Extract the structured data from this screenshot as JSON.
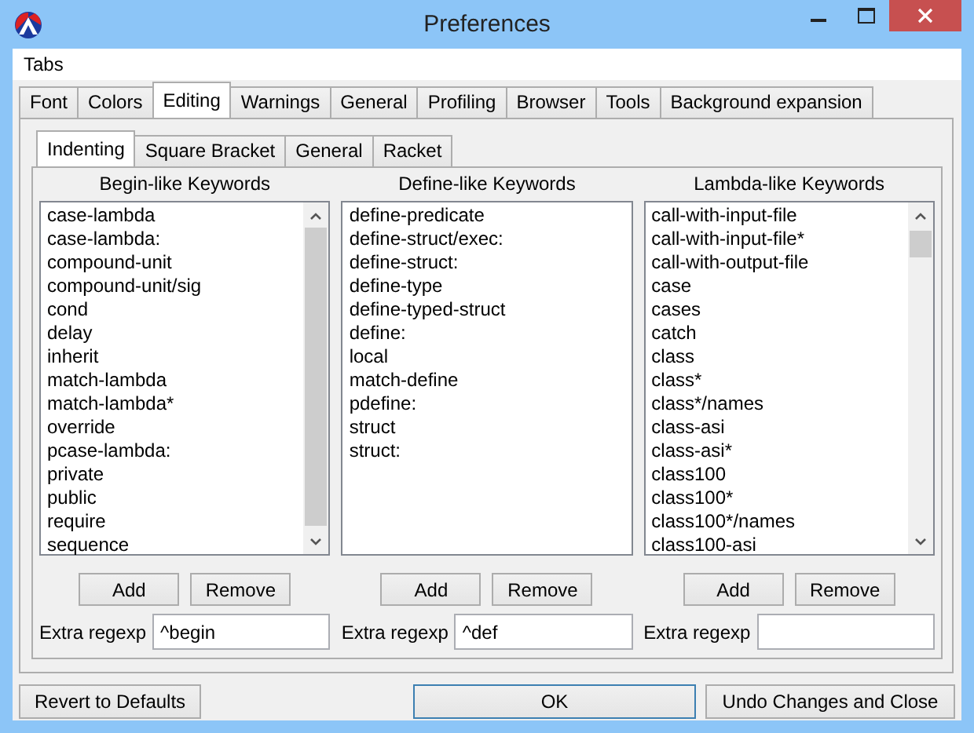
{
  "window": {
    "title": "Preferences"
  },
  "menu": [
    "Tabs"
  ],
  "tabs": [
    {
      "label": "Font",
      "selected": false
    },
    {
      "label": "Colors",
      "selected": false
    },
    {
      "label": "Editing",
      "selected": true
    },
    {
      "label": "Warnings",
      "selected": false
    },
    {
      "label": "General",
      "selected": false
    },
    {
      "label": "Profiling",
      "selected": false
    },
    {
      "label": "Browser",
      "selected": false
    },
    {
      "label": "Tools",
      "selected": false
    },
    {
      "label": "Background expansion",
      "selected": false
    }
  ],
  "subtabs": [
    {
      "label": "Indenting",
      "selected": true
    },
    {
      "label": "Square Bracket",
      "selected": false
    },
    {
      "label": "General",
      "selected": false
    },
    {
      "label": "Racket",
      "selected": false
    }
  ],
  "columns": [
    {
      "heading": "Begin-like Keywords",
      "items": [
        "case-lambda",
        "case-lambda:",
        "compound-unit",
        "compound-unit/sig",
        "cond",
        "delay",
        "inherit",
        "match-lambda",
        "match-lambda*",
        "override",
        "pcase-lambda:",
        "private",
        "public",
        "require",
        "sequence"
      ],
      "buttons": [
        "Add",
        "Remove"
      ],
      "regexp_label": "Extra regexp",
      "regexp_value": "^begin"
    },
    {
      "heading": "Define-like Keywords",
      "items": [
        "define-predicate",
        "define-struct/exec:",
        "define-struct:",
        "define-type",
        "define-typed-struct",
        "define:",
        "local",
        "match-define",
        "pdefine:",
        "struct",
        "struct:"
      ],
      "buttons": [
        "Add",
        "Remove"
      ],
      "regexp_label": "Extra regexp",
      "regexp_value": "^def"
    },
    {
      "heading": "Lambda-like Keywords",
      "items": [
        "call-with-input-file",
        "call-with-input-file*",
        "call-with-output-file",
        "case",
        "cases",
        "catch",
        "class",
        "class*",
        "class*/names",
        "class-asi",
        "class-asi*",
        "class100",
        "class100*",
        "class100*/names",
        "class100-asi"
      ],
      "buttons": [
        "Add",
        "Remove"
      ],
      "regexp_label": "Extra regexp"
    }
  ],
  "footer": {
    "revert": "Revert to Defaults",
    "ok": "OK",
    "undo": "Undo Changes and Close"
  }
}
